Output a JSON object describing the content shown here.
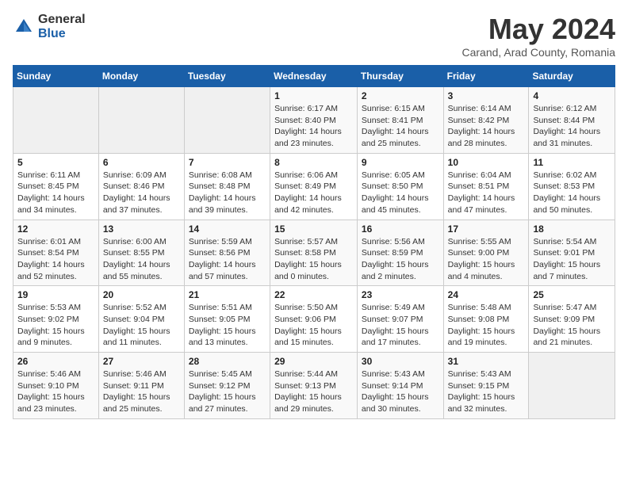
{
  "logo": {
    "general": "General",
    "blue": "Blue"
  },
  "title": {
    "month_year": "May 2024",
    "location": "Carand, Arad County, Romania"
  },
  "weekdays": [
    "Sunday",
    "Monday",
    "Tuesday",
    "Wednesday",
    "Thursday",
    "Friday",
    "Saturday"
  ],
  "weeks": [
    [
      {
        "day": "",
        "info": ""
      },
      {
        "day": "",
        "info": ""
      },
      {
        "day": "",
        "info": ""
      },
      {
        "day": "1",
        "info": "Sunrise: 6:17 AM\nSunset: 8:40 PM\nDaylight: 14 hours\nand 23 minutes."
      },
      {
        "day": "2",
        "info": "Sunrise: 6:15 AM\nSunset: 8:41 PM\nDaylight: 14 hours\nand 25 minutes."
      },
      {
        "day": "3",
        "info": "Sunrise: 6:14 AM\nSunset: 8:42 PM\nDaylight: 14 hours\nand 28 minutes."
      },
      {
        "day": "4",
        "info": "Sunrise: 6:12 AM\nSunset: 8:44 PM\nDaylight: 14 hours\nand 31 minutes."
      }
    ],
    [
      {
        "day": "5",
        "info": "Sunrise: 6:11 AM\nSunset: 8:45 PM\nDaylight: 14 hours\nand 34 minutes."
      },
      {
        "day": "6",
        "info": "Sunrise: 6:09 AM\nSunset: 8:46 PM\nDaylight: 14 hours\nand 37 minutes."
      },
      {
        "day": "7",
        "info": "Sunrise: 6:08 AM\nSunset: 8:48 PM\nDaylight: 14 hours\nand 39 minutes."
      },
      {
        "day": "8",
        "info": "Sunrise: 6:06 AM\nSunset: 8:49 PM\nDaylight: 14 hours\nand 42 minutes."
      },
      {
        "day": "9",
        "info": "Sunrise: 6:05 AM\nSunset: 8:50 PM\nDaylight: 14 hours\nand 45 minutes."
      },
      {
        "day": "10",
        "info": "Sunrise: 6:04 AM\nSunset: 8:51 PM\nDaylight: 14 hours\nand 47 minutes."
      },
      {
        "day": "11",
        "info": "Sunrise: 6:02 AM\nSunset: 8:53 PM\nDaylight: 14 hours\nand 50 minutes."
      }
    ],
    [
      {
        "day": "12",
        "info": "Sunrise: 6:01 AM\nSunset: 8:54 PM\nDaylight: 14 hours\nand 52 minutes."
      },
      {
        "day": "13",
        "info": "Sunrise: 6:00 AM\nSunset: 8:55 PM\nDaylight: 14 hours\nand 55 minutes."
      },
      {
        "day": "14",
        "info": "Sunrise: 5:59 AM\nSunset: 8:56 PM\nDaylight: 14 hours\nand 57 minutes."
      },
      {
        "day": "15",
        "info": "Sunrise: 5:57 AM\nSunset: 8:58 PM\nDaylight: 15 hours\nand 0 minutes."
      },
      {
        "day": "16",
        "info": "Sunrise: 5:56 AM\nSunset: 8:59 PM\nDaylight: 15 hours\nand 2 minutes."
      },
      {
        "day": "17",
        "info": "Sunrise: 5:55 AM\nSunset: 9:00 PM\nDaylight: 15 hours\nand 4 minutes."
      },
      {
        "day": "18",
        "info": "Sunrise: 5:54 AM\nSunset: 9:01 PM\nDaylight: 15 hours\nand 7 minutes."
      }
    ],
    [
      {
        "day": "19",
        "info": "Sunrise: 5:53 AM\nSunset: 9:02 PM\nDaylight: 15 hours\nand 9 minutes."
      },
      {
        "day": "20",
        "info": "Sunrise: 5:52 AM\nSunset: 9:04 PM\nDaylight: 15 hours\nand 11 minutes."
      },
      {
        "day": "21",
        "info": "Sunrise: 5:51 AM\nSunset: 9:05 PM\nDaylight: 15 hours\nand 13 minutes."
      },
      {
        "day": "22",
        "info": "Sunrise: 5:50 AM\nSunset: 9:06 PM\nDaylight: 15 hours\nand 15 minutes."
      },
      {
        "day": "23",
        "info": "Sunrise: 5:49 AM\nSunset: 9:07 PM\nDaylight: 15 hours\nand 17 minutes."
      },
      {
        "day": "24",
        "info": "Sunrise: 5:48 AM\nSunset: 9:08 PM\nDaylight: 15 hours\nand 19 minutes."
      },
      {
        "day": "25",
        "info": "Sunrise: 5:47 AM\nSunset: 9:09 PM\nDaylight: 15 hours\nand 21 minutes."
      }
    ],
    [
      {
        "day": "26",
        "info": "Sunrise: 5:46 AM\nSunset: 9:10 PM\nDaylight: 15 hours\nand 23 minutes."
      },
      {
        "day": "27",
        "info": "Sunrise: 5:46 AM\nSunset: 9:11 PM\nDaylight: 15 hours\nand 25 minutes."
      },
      {
        "day": "28",
        "info": "Sunrise: 5:45 AM\nSunset: 9:12 PM\nDaylight: 15 hours\nand 27 minutes."
      },
      {
        "day": "29",
        "info": "Sunrise: 5:44 AM\nSunset: 9:13 PM\nDaylight: 15 hours\nand 29 minutes."
      },
      {
        "day": "30",
        "info": "Sunrise: 5:43 AM\nSunset: 9:14 PM\nDaylight: 15 hours\nand 30 minutes."
      },
      {
        "day": "31",
        "info": "Sunrise: 5:43 AM\nSunset: 9:15 PM\nDaylight: 15 hours\nand 32 minutes."
      },
      {
        "day": "",
        "info": ""
      }
    ]
  ]
}
